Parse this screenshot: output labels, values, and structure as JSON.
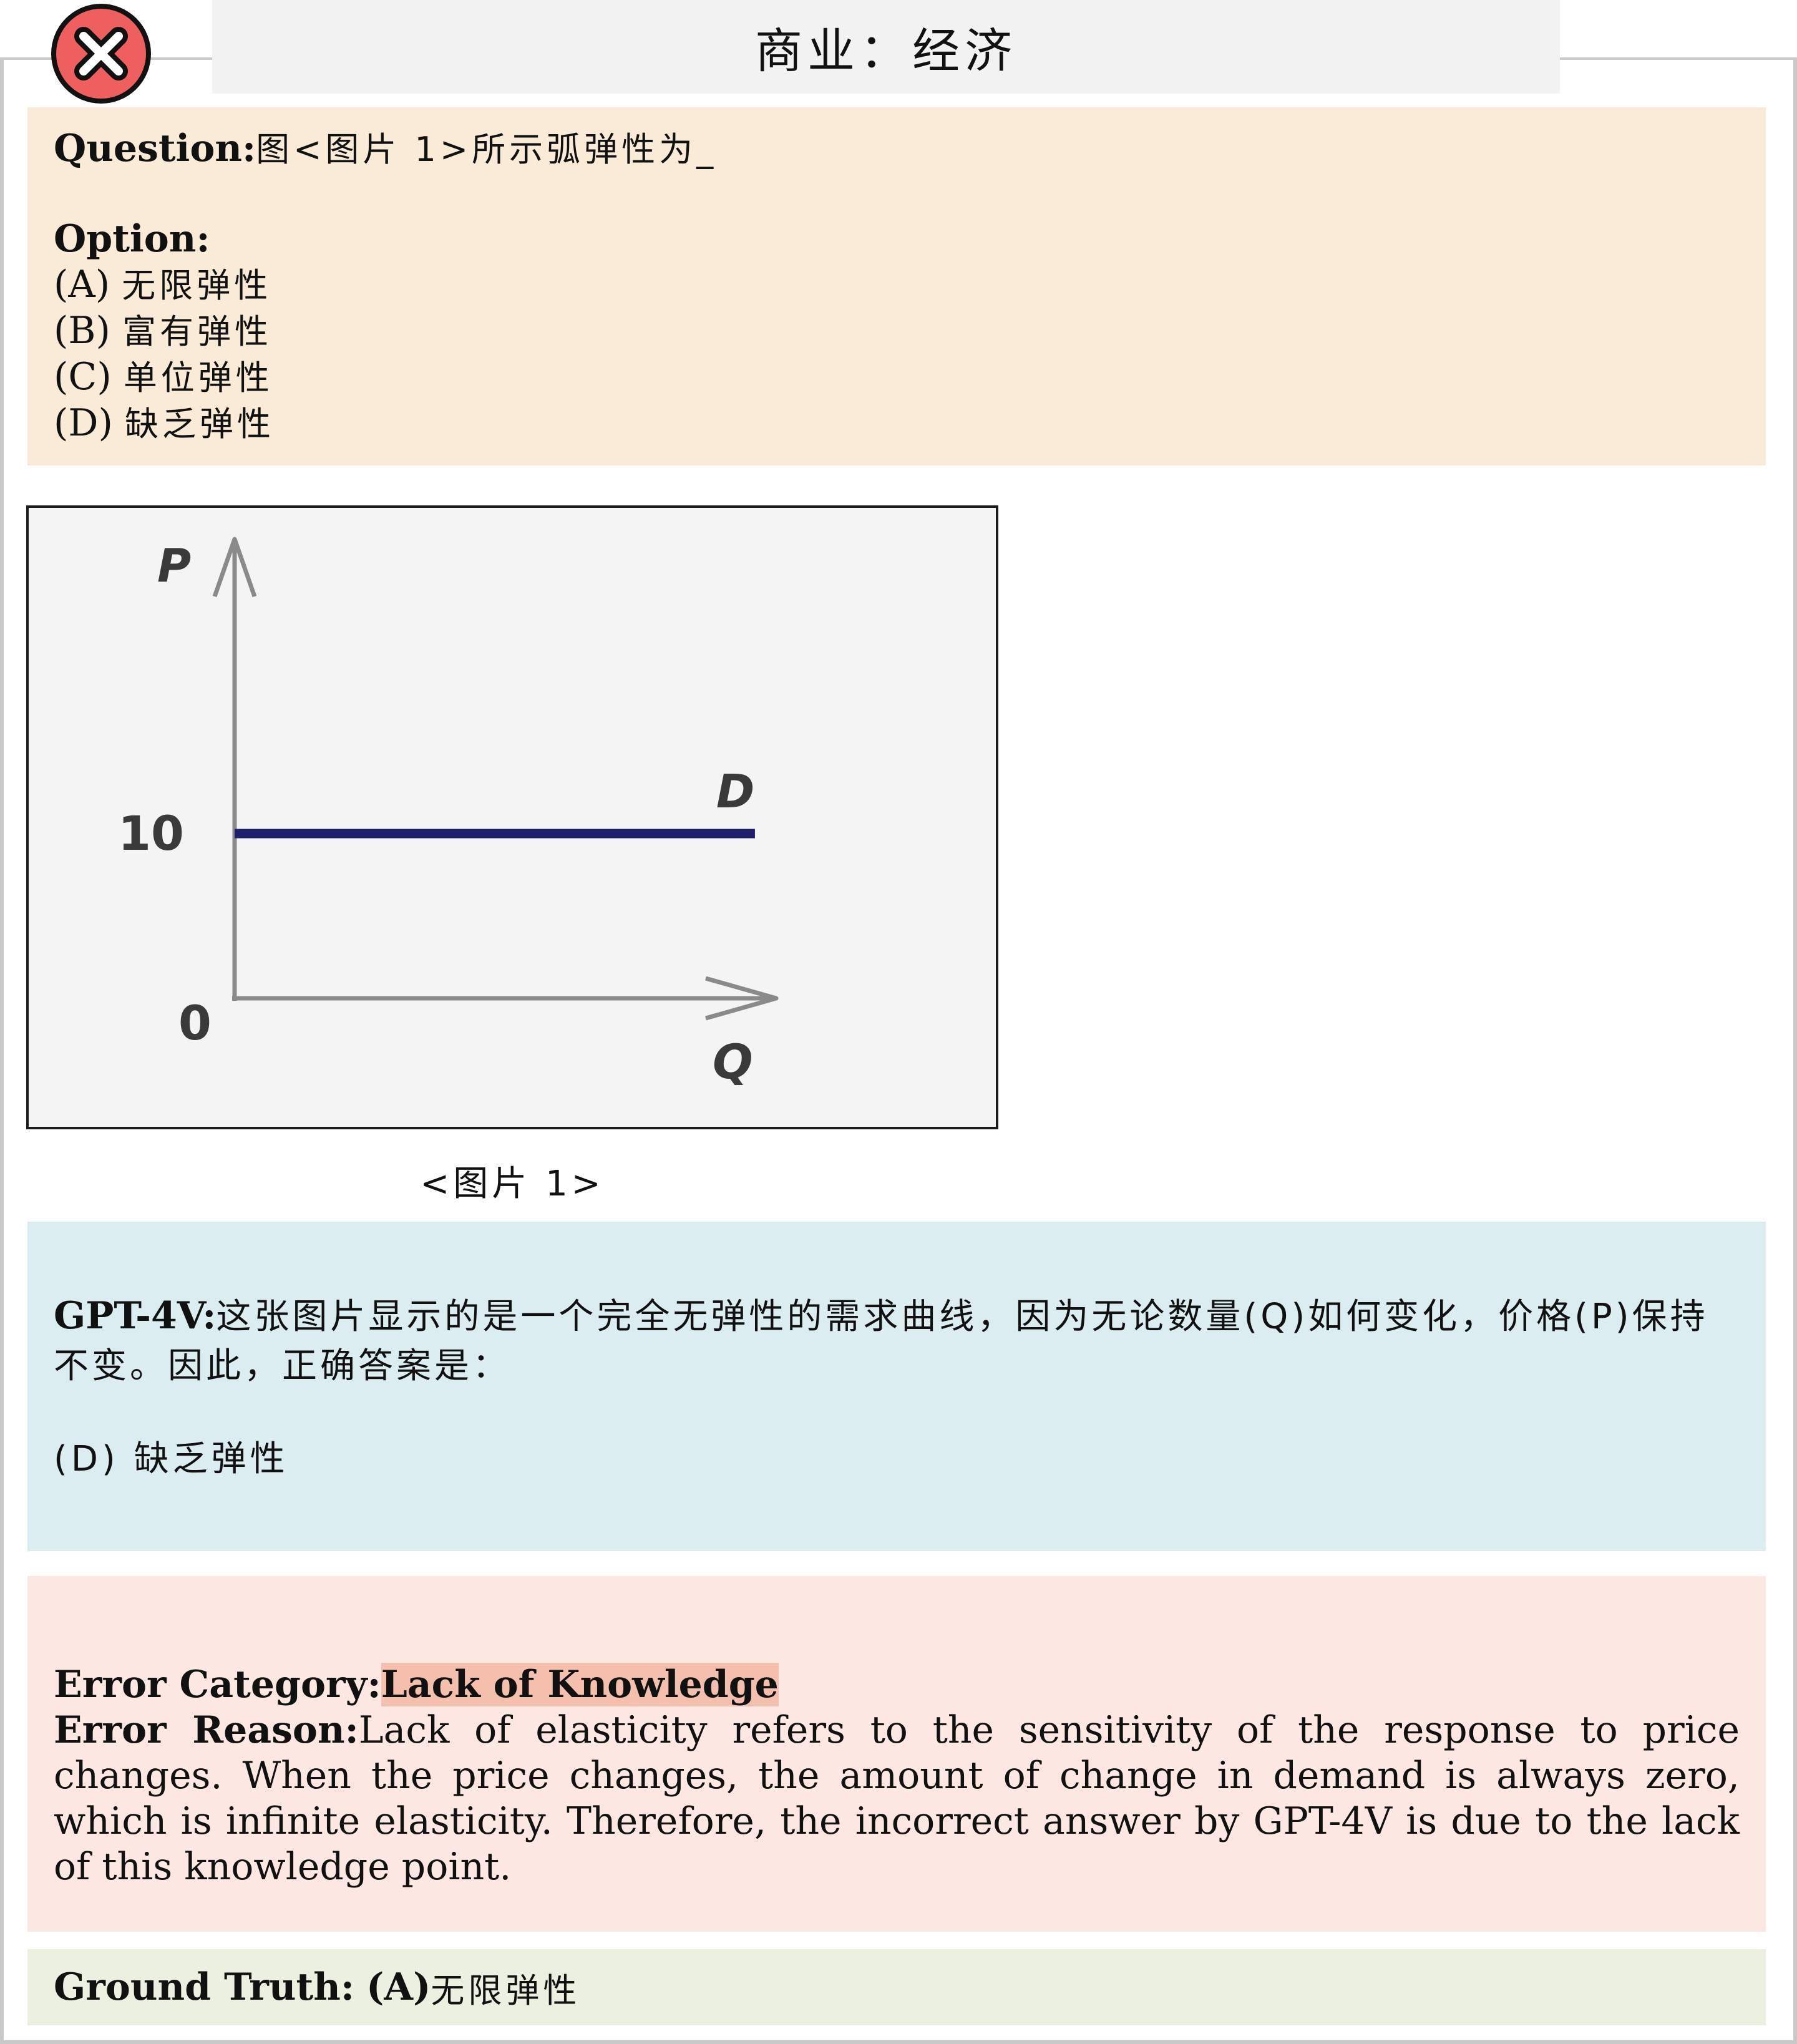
{
  "header": {
    "title": "商业：经济",
    "status_icon": "close-icon",
    "status_color": "#ef5f5f"
  },
  "question": {
    "label": "Question:",
    "text": "图<图片 1>所示弧弹性为_",
    "option_label": "Option:",
    "options": [
      {
        "key": "(A)",
        "text": "无限弹性"
      },
      {
        "key": "(B)",
        "text": "富有弹性"
      },
      {
        "key": "(C)",
        "text": "单位弹性"
      },
      {
        "key": "(D)",
        "text": "缺乏弹性"
      }
    ]
  },
  "figure": {
    "caption": "<图片 1>",
    "chart_data": {
      "type": "line",
      "title": "",
      "xlabel": "Q",
      "ylabel": "P",
      "origin_label": "0",
      "y_ticks": [
        "10"
      ],
      "series": [
        {
          "name": "D",
          "x": [
            0,
            1
          ],
          "y": [
            10,
            10
          ]
        }
      ],
      "grid": false,
      "line_color": "#1f1f6e"
    }
  },
  "gpt": {
    "label": "GPT-4V:",
    "text": "这张图片显示的是一个完全无弹性的需求曲线，因为无论数量(Q)如何变化，价格(P)保持不变。因此，正确答案是：",
    "answer": "(D) 缺乏弹性"
  },
  "error": {
    "category_label": "Error Category:",
    "category": "Lack of Knowledge",
    "reason_label": "Error Reason:",
    "reason": "Lack of elasticity refers to the sensitivity of the response to price changes. When the price changes, the amount of change in demand is always zero, which is infinite elasticity. Therefore, the incorrect answer by GPT-4V is due to the lack of this knowledge point."
  },
  "ground_truth": {
    "label": "Ground Truth:",
    "key": "(A)",
    "text": "无限弹性"
  }
}
